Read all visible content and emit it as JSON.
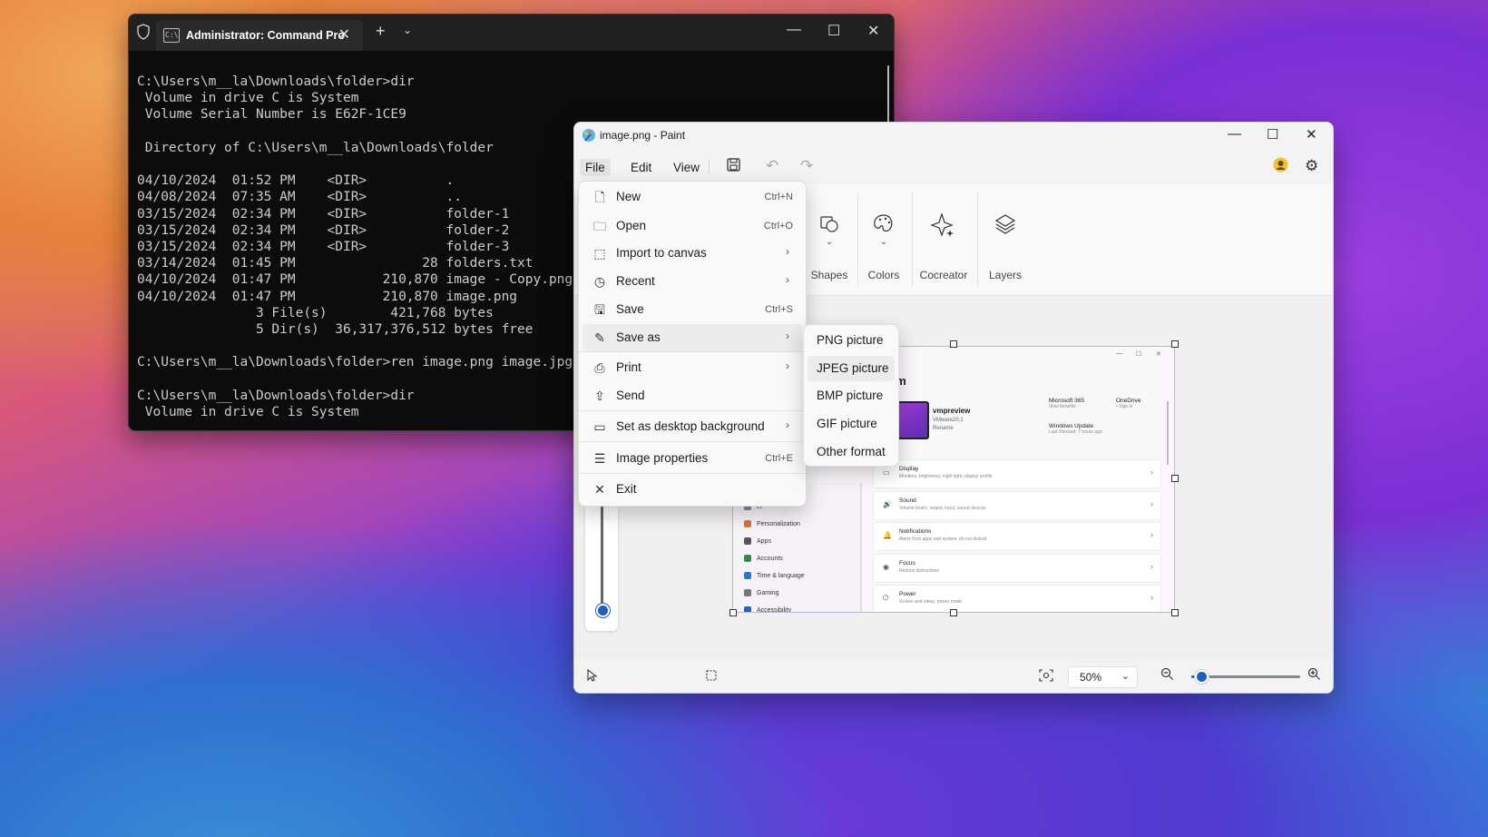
{
  "terminal": {
    "tab_title": "Administrator: Command Pro",
    "new_tab": "+",
    "lines": [
      "C:\\Users\\m__la\\Downloads\\folder>dir",
      " Volume in drive C is System",
      " Volume Serial Number is E62F-1CE9",
      "",
      " Directory of C:\\Users\\m__la\\Downloads\\folder",
      "",
      "04/10/2024  01:52 PM    <DIR>          .",
      "04/08/2024  07:35 AM    <DIR>          ..",
      "03/15/2024  02:34 PM    <DIR>          folder-1",
      "03/15/2024  02:34 PM    <DIR>          folder-2",
      "03/15/2024  02:34 PM    <DIR>          folder-3",
      "03/14/2024  01:45 PM                28 folders.txt",
      "04/10/2024  01:47 PM           210,870 image - Copy.png",
      "04/10/2024  01:47 PM           210,870 image.png",
      "               3 File(s)        421,768 bytes",
      "               5 Dir(s)  36,317,376,512 bytes free",
      "",
      "C:\\Users\\m__la\\Downloads\\folder>ren image.png image.jpg",
      "",
      "C:\\Users\\m__la\\Downloads\\folder>dir",
      " Volume in drive C is System"
    ]
  },
  "paint": {
    "title": "image.png - Paint",
    "menus": [
      "File",
      "Edit",
      "View"
    ],
    "ribbon": {
      "shapes": "Shapes",
      "colors": "Colors",
      "cocreator": "Cocreator",
      "layers": "Layers"
    },
    "zoom": "50%",
    "zoom_level": 0.08
  },
  "file_menu": {
    "items": [
      {
        "label": "New",
        "shortcut": "Ctrl+N",
        "icon": "new-file-icon"
      },
      {
        "label": "Open",
        "shortcut": "Ctrl+O",
        "icon": "folder-icon"
      },
      {
        "label": "Import to canvas",
        "shortcut": "",
        "icon": "import-icon"
      },
      {
        "label": "Recent",
        "shortcut": "",
        "icon": "clock-icon"
      },
      {
        "label": "Save",
        "shortcut": "Ctrl+S",
        "icon": "save-icon"
      },
      {
        "label": "Save as",
        "shortcut": "",
        "icon": "save-as-icon"
      },
      {
        "label": "Print",
        "shortcut": "",
        "icon": "print-icon"
      },
      {
        "label": "Send",
        "shortcut": "",
        "icon": "share-icon"
      },
      {
        "label": "Set as desktop background",
        "shortcut": "",
        "icon": "desktop-icon"
      },
      {
        "label": "Image properties",
        "shortcut": "Ctrl+E",
        "icon": "properties-icon"
      },
      {
        "label": "Exit",
        "shortcut": "",
        "icon": "close-icon"
      }
    ]
  },
  "save_as_menu": {
    "items": [
      "PNG picture",
      "JPEG picture",
      "BMP picture",
      "GIF picture",
      "Other format"
    ]
  },
  "canvas_image": {
    "heading": "em",
    "device_name": "vmpreview",
    "device_sub": "VMware20,1",
    "device_rename": "Rename",
    "ms365": "Microsoft 365",
    "ms365_sub": "View benefits",
    "onedrive": "OneDrive",
    "onedrive_sub": "• Sign in",
    "winupdate": "Windows Update",
    "winupdate_sub": "Last checked: 7 hours ago",
    "sidebar": [
      "ces",
      "et",
      "Personalization",
      "Apps",
      "Accounts",
      "Time & language",
      "Gaming",
      "Accessibility"
    ],
    "rows": [
      {
        "title": "Display",
        "sub": "Monitors, brightness, night light, display profile"
      },
      {
        "title": "Sound",
        "sub": "Volume levels, output, input, sound devices"
      },
      {
        "title": "Notifications",
        "sub": "Alerts from apps and system, do not disturb"
      },
      {
        "title": "Focus",
        "sub": "Reduce distractions"
      },
      {
        "title": "Power",
        "sub": "Screen and sleep, power mode"
      }
    ]
  }
}
